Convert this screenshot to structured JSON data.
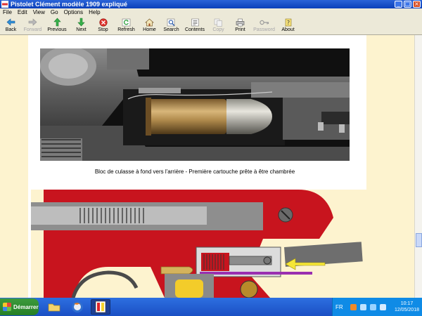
{
  "window": {
    "title": "Pistolet Clément modèle 1909 expliqué"
  },
  "menu": [
    "File",
    "Edit",
    "View",
    "Go",
    "Options",
    "Help"
  ],
  "toolbar": {
    "back": "Back",
    "forward": "Forward",
    "previous": "Previous",
    "next": "Next",
    "stop": "Stop",
    "refresh": "Refresh",
    "home": "Home",
    "search": "Search",
    "contents": "Contents",
    "copy": "Copy",
    "print": "Print",
    "password": "Password",
    "about": "About"
  },
  "content": {
    "caption": "Bloc de culasse à fond vers l'arrière - Première cartouche prête à être chambrée"
  },
  "taskbar": {
    "start_label": "Démarrer",
    "language": "FR",
    "time": "10:17",
    "date": "12/05/2018"
  },
  "colors": {
    "titlebar": "#0a3fb9",
    "page_margin": "#fdf3cf",
    "diagram_red": "#c8141e",
    "arrow_yellow": "#f5e636",
    "rod_purple": "#9a2fb0"
  }
}
